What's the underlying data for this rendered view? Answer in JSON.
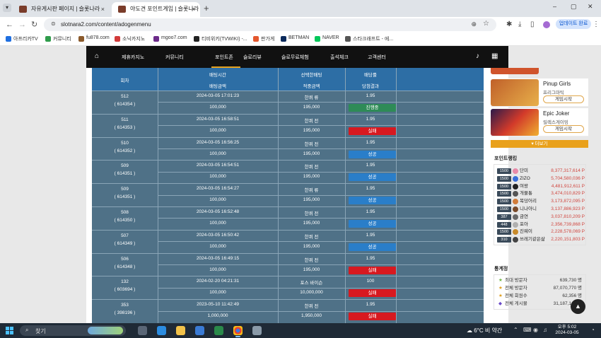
{
  "browser": {
    "tabs": [
      {
        "label": "자유게시판 페이지 | 슬롯나라",
        "close": "×"
      },
      {
        "label": "야도견 포인트게임 | 슬롯나라",
        "close": "×"
      }
    ],
    "new_tab": "+",
    "window": {
      "minimize": "–",
      "maximize": "▢",
      "close": "✕"
    },
    "url": "slotnara2.com/content/adogenmenu",
    "update_button": "업데이트 완료",
    "bookmarks": [
      {
        "label": "아프리카TV",
        "color": "#1f6fe0"
      },
      {
        "label": "커뮤니티",
        "color": "#2f9c4b"
      },
      {
        "label": "fu878.com",
        "color": "#8b5a2b"
      },
      {
        "label": "소닉카지노",
        "color": "#d23a3a"
      },
      {
        "label": "mgoo7.com",
        "color": "#6c2b8a"
      },
      {
        "label": "티비위키(TVWIKI) -...",
        "color": "#222222"
      },
      {
        "label": "판가게",
        "color": "#e4572e"
      },
      {
        "label": "BETMAN",
        "color": "#0b2a5b"
      },
      {
        "label": "NAVER",
        "color": "#03c75a"
      },
      {
        "label": "스타크래프트 - 에...",
        "color": "#555555"
      }
    ]
  },
  "site_nav": {
    "items": [
      "제휴카지노",
      "커뮤니티",
      "포인트존",
      "슬로리뷰",
      "슬로무료체험",
      "출석체크",
      "고객센터"
    ],
    "active": "포인트존"
  },
  "table": {
    "headers": {
      "round": "회차",
      "bet_time": "배팅시간",
      "selected_bet": "선택한배팅",
      "dividend": "배당률",
      "bet_amount": "배팅금액",
      "hit_amount": "적중금액",
      "result": "당첨결과"
    },
    "rows": [
      {
        "round": "512",
        "id": "( 614354 )",
        "time": "2024-03-05 17:01:23",
        "pick": "한퀴 류",
        "odds": "1.95",
        "amount": "100,000",
        "win": "195,000",
        "result": "진행중",
        "status": "wait"
      },
      {
        "round": "511",
        "id": "( 614353 )",
        "time": "2024-03-05 16:58:51",
        "pick": "한퀴 전",
        "odds": "1.95",
        "amount": "100,000",
        "win": "195,000",
        "result": "실패",
        "status": "lose"
      },
      {
        "round": "510",
        "id": "( 614352 )",
        "time": "2024-03-05 16:56:25",
        "pick": "한퀴 전",
        "odds": "1.95",
        "amount": "100,000",
        "win": "195,000",
        "result": "성공",
        "status": "win"
      },
      {
        "round": "509",
        "id": "( 614351 )",
        "time": "2024-03-05 16:54:51",
        "pick": "한퀴 전",
        "odds": "1.95",
        "amount": "100,000",
        "win": "195,000",
        "result": "성공",
        "status": "win"
      },
      {
        "round": "509",
        "id": "( 614351 )",
        "time": "2024-03-05 16:54:27",
        "pick": "한퀴 류",
        "odds": "1.95",
        "amount": "100,000",
        "win": "195,000",
        "result": "성공",
        "status": "win"
      },
      {
        "round": "508",
        "id": "( 614350 )",
        "time": "2024-03-05 16:52:48",
        "pick": "한퀴 전",
        "odds": "1.95",
        "amount": "100,000",
        "win": "195,000",
        "result": "성공",
        "status": "win"
      },
      {
        "round": "507",
        "id": "( 614349 )",
        "time": "2024-03-05 16:50:42",
        "pick": "한퀴 전",
        "odds": "1.95",
        "amount": "100,000",
        "win": "195,000",
        "result": "성공",
        "status": "win"
      },
      {
        "round": "506",
        "id": "( 614348 )",
        "time": "2024-03-05 16:49:15",
        "pick": "한퀴 전",
        "odds": "1.95",
        "amount": "100,000",
        "win": "195,000",
        "result": "실패",
        "status": "lose"
      },
      {
        "round": "132",
        "id": "( 603694 )",
        "time": "2024-02-20 04:21:31",
        "pick": "포스 바이슨",
        "odds": "100",
        "amount": "100,000",
        "win": "10,000,000",
        "result": "실패",
        "status": "lose"
      },
      {
        "round": "353",
        "id": "( 398196 )",
        "time": "2023-05-10 11:42:49",
        "pick": "한퀴 전",
        "odds": "1.95",
        "amount": "1,000,000",
        "win": "1,950,000",
        "result": "실패",
        "status": "lose"
      }
    ]
  },
  "sidebar": {
    "games": [
      {
        "title": "Pinup Girls",
        "provider": "프리그마틱",
        "play": "게임시작",
        "color": "#b5452a"
      },
      {
        "title": "Epic Joker",
        "provider": "릴렉스게이밍",
        "play": "게임시작",
        "color": "#c0392b"
      }
    ],
    "more": "▾ 더보기",
    "ranking_title": "포인트랭킹",
    "ranking": [
      {
        "level": "1500",
        "name": "단미",
        "points": "8,377,317,614 P",
        "color": "#e88aa8"
      },
      {
        "level": "1500",
        "name": "ZIZO",
        "points": "5,704,580,036 P",
        "color": "#3a6fd8"
      },
      {
        "level": "1500",
        "name": "여왕",
        "points": "4,481,912,611 P",
        "color": "#222222"
      },
      {
        "level": "1500",
        "name": "개물통",
        "points": "3,474,010,829 P",
        "color": "#555555"
      },
      {
        "level": "1500",
        "name": "복덩어리",
        "points": "3,173,872,095 P",
        "color": "#d27c3a"
      },
      {
        "level": "1500",
        "name": "니나아니",
        "points": "3,137,886,923 P",
        "color": "#7a4a2a"
      },
      {
        "level": "387",
        "name": "금연",
        "points": "3,037,810,209 P",
        "color": "#6a6a6a"
      },
      {
        "level": "448",
        "name": "포아",
        "points": "2,356,739,868 P",
        "color": "#b0b0b0"
      },
      {
        "level": "1500",
        "name": "진웨이",
        "points": "2,228,578,069 P",
        "color": "#c88a2a"
      },
      {
        "level": "310",
        "name": "쓰레기같은삶",
        "points": "2,220,151,803 P",
        "color": "#444444"
      }
    ],
    "stats_title": "통계정",
    "stats": [
      {
        "icon": "★",
        "label": "최대 방문자",
        "value": "639,730 명"
      },
      {
        "icon": "★",
        "label": "전체 방문자",
        "value": "87,070,770 명"
      },
      {
        "icon": "★",
        "label": "전체 회원수",
        "value": "62,356 명"
      },
      {
        "icon": "◆",
        "label": "전체 게시물",
        "value": "31,187,149 개"
      }
    ]
  },
  "taskbar": {
    "search": "찾기",
    "weather": "6°C  비 약간",
    "time": "오후 5:02",
    "date": "2024-03-05"
  }
}
